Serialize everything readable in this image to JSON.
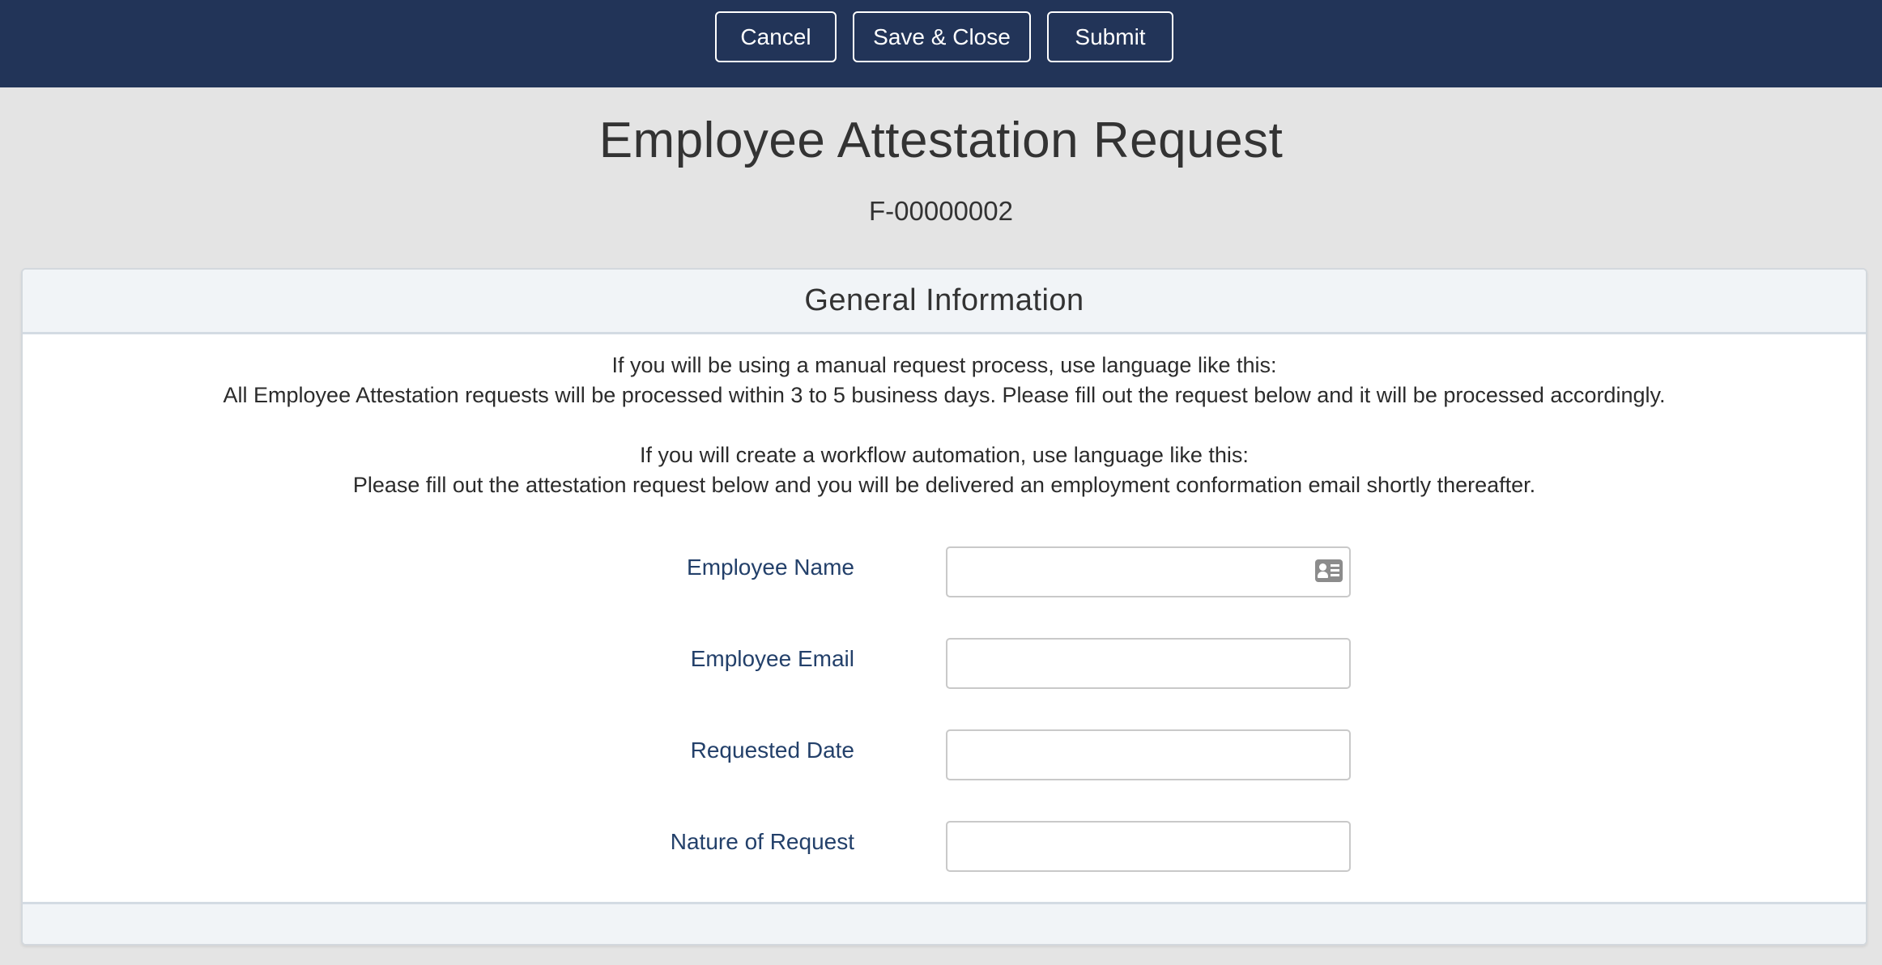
{
  "toolbar": {
    "cancel_label": "Cancel",
    "save_close_label": "Save & Close",
    "submit_label": "Submit"
  },
  "page": {
    "title": "Employee Attestation Request",
    "record_id": "F-00000002"
  },
  "section": {
    "title": "General Information",
    "intro": {
      "line1": "If you will be using a manual request process, use language like this:",
      "line2": "All Employee Attestation requests will be processed within 3 to 5 business days. Please fill out the request below and it will be processed accordingly.",
      "line3": "If you will create a workflow automation, use language like this:",
      "line4": "Please fill out the attestation request below and you will be delivered an employment conformation email shortly thereafter."
    },
    "fields": {
      "employee_name": {
        "label": "Employee Name",
        "value": "",
        "icon": "contact-card-icon"
      },
      "employee_email": {
        "label": "Employee Email",
        "value": ""
      },
      "requested_date": {
        "label": "Requested Date",
        "value": ""
      },
      "nature_of_request": {
        "label": "Nature of Request",
        "value": ""
      }
    }
  },
  "colors": {
    "header_bg": "#223458",
    "page_bg": "#e4e4e4",
    "label_color": "#23406a",
    "section_header_bg": "#f1f4f7"
  }
}
